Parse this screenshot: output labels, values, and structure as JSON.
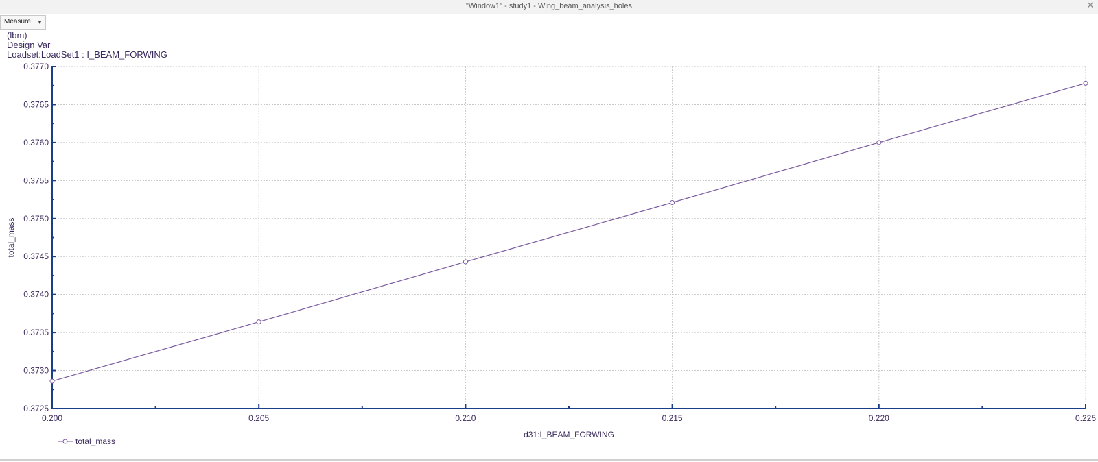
{
  "window": {
    "title": "\"Window1\" - study1 - Wing_beam_analysis_holes",
    "close_icon": "close-icon"
  },
  "toolbar": {
    "measure_label": "Measure",
    "dropdown_icon": "chevron-down-icon"
  },
  "header": {
    "unit": "(lbm)",
    "design_var": "Design Var",
    "loadset": "Loadset:LoadSet1 :  I_BEAM_FORWING"
  },
  "colors": {
    "series": "#7a5a9e",
    "axis": "#1a3f8a",
    "grid": "#c8c8c8",
    "text": "#3b2a5c"
  },
  "chart_data": {
    "type": "line",
    "xlabel": "d31:I_BEAM_FORWING",
    "ylabel": "total_mass",
    "xlim": [
      0.2,
      0.225
    ],
    "ylim": [
      0.3725,
      0.377
    ],
    "x_ticks": [
      "0.200",
      "0.205",
      "0.210",
      "0.215",
      "0.220",
      "0.225"
    ],
    "y_ticks": [
      "0.3725",
      "0.3730",
      "0.3735",
      "0.3740",
      "0.3745",
      "0.3750",
      "0.3755",
      "0.3760",
      "0.3765",
      "0.3770"
    ],
    "grid": true,
    "legend_position": "bottom-left",
    "series": [
      {
        "name": "total_mass",
        "marker": "circle",
        "x": [
          0.2,
          0.205,
          0.21,
          0.215,
          0.22,
          0.225
        ],
        "y": [
          0.37286,
          0.37364,
          0.37443,
          0.37521,
          0.376,
          0.37678
        ]
      }
    ]
  }
}
